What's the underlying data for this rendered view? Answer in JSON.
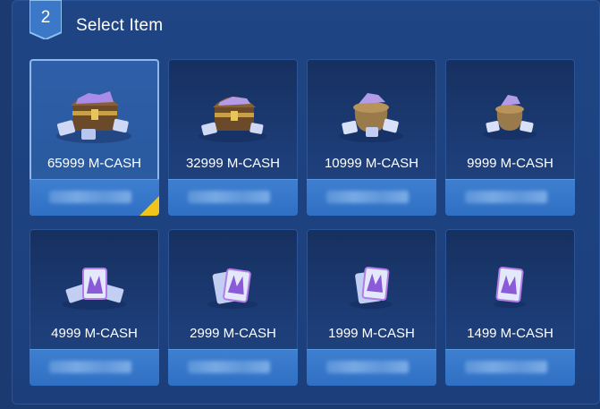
{
  "header": {
    "step_number": "2",
    "title": "Select Item"
  },
  "colors": {
    "panel": "#1f4584",
    "card": "#1d3d78",
    "card_selected": "#2f5fa8",
    "price_bar": "#3574c8",
    "selected_flag": "#f0c419"
  },
  "items": [
    {
      "amount": "65999 M-CASH",
      "icon": "large-treasure-chest-icon",
      "selected": true
    },
    {
      "amount": "32999 M-CASH",
      "icon": "treasure-chest-icon",
      "selected": false
    },
    {
      "amount": "10999 M-CASH",
      "icon": "sack-of-cards-icon",
      "selected": false
    },
    {
      "amount": "9999 M-CASH",
      "icon": "small-sack-of-cards-icon",
      "selected": false
    },
    {
      "amount": "4999 M-CASH",
      "icon": "card-pile-icon",
      "selected": false
    },
    {
      "amount": "2999 M-CASH",
      "icon": "card-stack-icon",
      "selected": false
    },
    {
      "amount": "1999 M-CASH",
      "icon": "card-pair-icon",
      "selected": false
    },
    {
      "amount": "1499 M-CASH",
      "icon": "single-card-icon",
      "selected": false
    }
  ]
}
